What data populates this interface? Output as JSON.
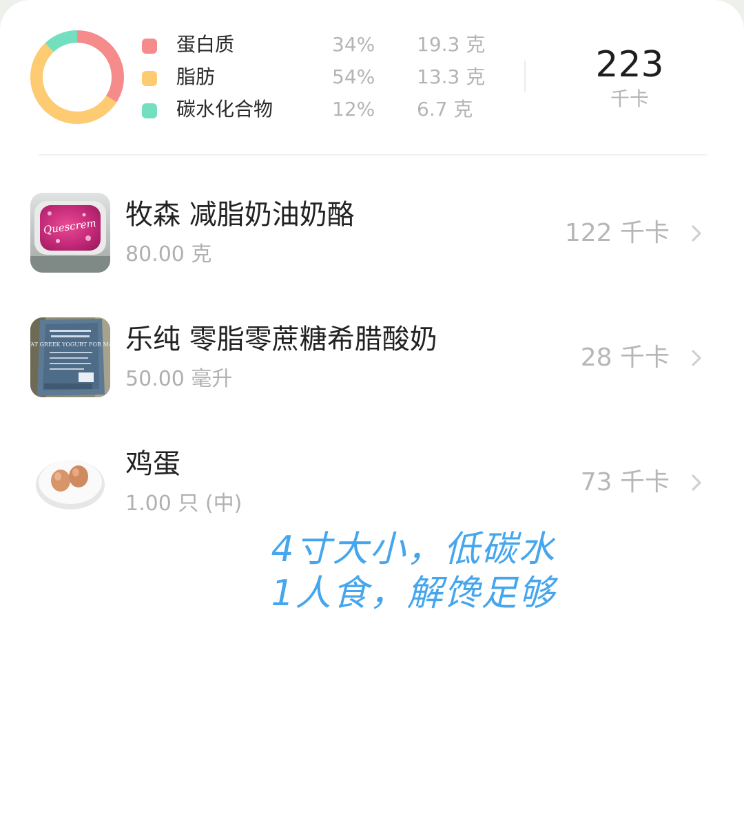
{
  "summary": {
    "macros": [
      {
        "name": "蛋白质",
        "percent": "34%",
        "grams": "19.3 克",
        "color": "#f58b8b"
      },
      {
        "name": "脂肪",
        "percent": "54%",
        "grams": "13.3 克",
        "color": "#fccb72"
      },
      {
        "name": "碳水化合物",
        "percent": "12%",
        "grams": "6.7 克",
        "color": "#72e0bf"
      }
    ],
    "total_value": "223",
    "total_unit": "千卡"
  },
  "foods": [
    {
      "name": "牧森 减脂奶油奶酪",
      "amount": "80.00 克",
      "kcal": "122 千卡"
    },
    {
      "name": "乐纯 零脂零蔗糖希腊酸奶",
      "amount": "50.00 毫升",
      "kcal": "28 千卡"
    },
    {
      "name": "鸡蛋",
      "amount": "1.00 只 (中)",
      "kcal": "73 千卡"
    }
  ],
  "thumb_texts": {
    "cheese_brand": "Quescrem",
    "yogurt_label": "ZERO-FAT GREEK YOGURT FOR MASTERS"
  },
  "note": {
    "line1": "4寸大小，低碳水",
    "line2": "1人食，解馋足够"
  }
}
